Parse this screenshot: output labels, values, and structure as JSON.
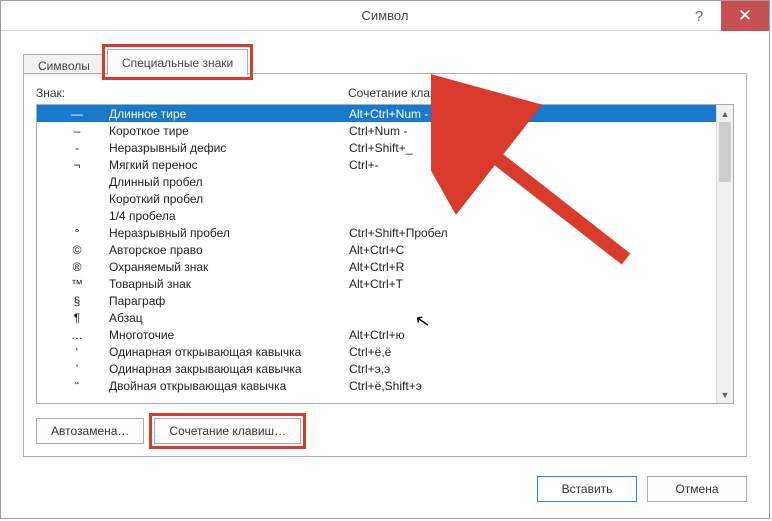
{
  "window": {
    "title": "Символ"
  },
  "tabs": {
    "symbols": "Символы",
    "special": "Специальные знаки"
  },
  "headers": {
    "sign": "Знак:",
    "shortcut": "Сочетание клавиш:"
  },
  "rows": [
    {
      "sym": "—",
      "name": "Длинное тире",
      "shortcut": "Alt+Ctrl+Num -",
      "selected": true
    },
    {
      "sym": "–",
      "name": "Короткое тире",
      "shortcut": "Ctrl+Num -"
    },
    {
      "sym": "-",
      "name": "Неразрывный дефис",
      "shortcut": "Ctrl+Shift+_"
    },
    {
      "sym": "¬",
      "name": "Мягкий перенос",
      "shortcut": "Ctrl+-"
    },
    {
      "sym": "",
      "name": "Длинный пробел",
      "shortcut": ""
    },
    {
      "sym": "",
      "name": "Короткий пробел",
      "shortcut": ""
    },
    {
      "sym": "",
      "name": "1/4 пробела",
      "shortcut": ""
    },
    {
      "sym": "°",
      "name": "Неразрывный пробел",
      "shortcut": "Ctrl+Shift+Пробел"
    },
    {
      "sym": "©",
      "name": "Авторское право",
      "shortcut": "Alt+Ctrl+C"
    },
    {
      "sym": "®",
      "name": "Охраняемый знак",
      "shortcut": "Alt+Ctrl+R"
    },
    {
      "sym": "™",
      "name": "Товарный знак",
      "shortcut": "Alt+Ctrl+T"
    },
    {
      "sym": "§",
      "name": "Параграф",
      "shortcut": ""
    },
    {
      "sym": "¶",
      "name": "Абзац",
      "shortcut": ""
    },
    {
      "sym": "…",
      "name": "Многоточие",
      "shortcut": "Alt+Ctrl+ю"
    },
    {
      "sym": "‘",
      "name": "Одинарная открывающая кавычка",
      "shortcut": "Ctrl+ё,ё"
    },
    {
      "sym": "’",
      "name": "Одинарная закрывающая кавычка",
      "shortcut": "Ctrl+э,э"
    },
    {
      "sym": "“",
      "name": "Двойная открывающая кавычка",
      "shortcut": "Ctrl+ё,Shift+э"
    }
  ],
  "buttons": {
    "autoreplace": "Автозамена…",
    "shortcut": "Сочетание клавиш…",
    "insert": "Вставить",
    "cancel": "Отмена"
  }
}
